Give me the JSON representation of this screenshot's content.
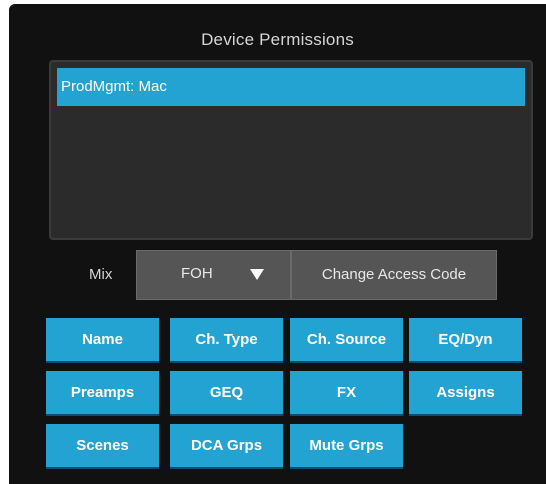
{
  "window": {
    "title": "Device Permissions"
  },
  "devices": [
    {
      "label": "ProdMgmt: Mac",
      "selected": true
    }
  ],
  "mix": {
    "label": "Mix",
    "value": "FOH"
  },
  "access_code_button": "Change Access Code",
  "permissions": [
    {
      "label": "Name"
    },
    {
      "label": "Ch. Type"
    },
    {
      "label": "Ch. Source"
    },
    {
      "label": "EQ/Dyn"
    },
    {
      "label": "Preamps"
    },
    {
      "label": "GEQ"
    },
    {
      "label": "FX"
    },
    {
      "label": "Assigns"
    },
    {
      "label": "Scenes"
    },
    {
      "label": "DCA Grps"
    },
    {
      "label": "Mute Grps"
    }
  ],
  "colors": {
    "accent": "#23a3d1",
    "panel": "#111111",
    "list_bg": "#2b2b2b",
    "control_bg": "#555555"
  },
  "icons": {
    "dropdown": "triangle-down-icon"
  }
}
